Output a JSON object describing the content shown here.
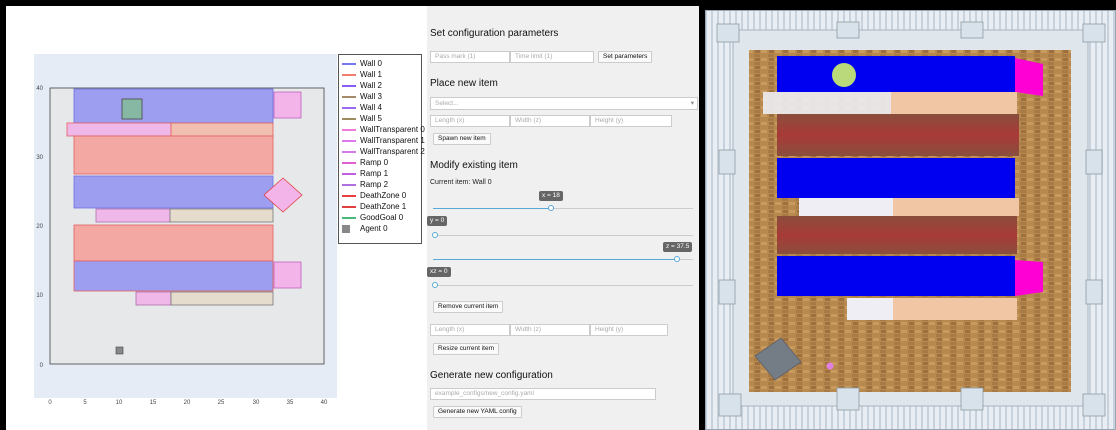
{
  "plot": {
    "x_ticks": [
      "0",
      "5",
      "10",
      "15",
      "20",
      "25",
      "30",
      "35",
      "40"
    ],
    "y_ticks": [
      "0",
      "10",
      "20",
      "30",
      "40"
    ],
    "legend": [
      {
        "label": "Wall 0",
        "color": "#7777ee"
      },
      {
        "label": "Wall 1",
        "color": "#f07f6f"
      },
      {
        "label": "Wall 2",
        "color": "#8b5cf6"
      },
      {
        "label": "Wall 3",
        "color": "#a48c6a"
      },
      {
        "label": "Wall 4",
        "color": "#9a6bf0"
      },
      {
        "label": "Wall 5",
        "color": "#9c8b5c"
      },
      {
        "label": "WallTransparent 0",
        "color": "#f07bd8"
      },
      {
        "label": "WallTransparent 1",
        "color": "#e079f0"
      },
      {
        "label": "WallTransparent 2",
        "color": "#d47ae8"
      },
      {
        "label": "Ramp 0",
        "color": "#e060d0"
      },
      {
        "label": "Ramp 1",
        "color": "#c060e0"
      },
      {
        "label": "Ramp 2",
        "color": "#b070e0"
      },
      {
        "label": "DeathZone 0",
        "color": "#e84040"
      },
      {
        "label": "DeathZone 1",
        "color": "#e04040"
      },
      {
        "label": "GoodGoal 0",
        "color": "#4ab87a"
      },
      {
        "label": "Agent 0",
        "color": "#888888"
      }
    ]
  },
  "controls": {
    "set_params_title": "Set configuration parameters",
    "pass_mark_placeholder": "Pass mark (1)",
    "time_limit_placeholder": "Time limit (1)",
    "set_params_button": "Set parameters",
    "place_title": "Place new item",
    "select_placeholder": "Select...",
    "length_placeholder": "Length (x)",
    "width_placeholder": "Width (z)",
    "height_placeholder": "Height (y)",
    "spawn_button": "Spawn new item",
    "modify_title": "Modify existing item",
    "current_item": "Current item: Wall 0",
    "slider_x_label": "x = 18",
    "slider_y_label": "y = 0",
    "slider_z_label": "z = 37.5",
    "slider_xz_label": "xz = 0",
    "slider_x_value": 0.45,
    "slider_y_value": 0.0,
    "slider_z_value": 0.94,
    "slider_xz_value": 0.0,
    "remove_button": "Remove current item",
    "resize_length_placeholder": "Length (x)",
    "resize_width_placeholder": "Width (z)",
    "resize_height_placeholder": "Height (y)",
    "resize_button": "Resize current item",
    "generate_title": "Generate new configuration",
    "config_path_placeholder": "example_configs/new_config.yaml",
    "generate_button": "Generate new YAML config"
  }
}
